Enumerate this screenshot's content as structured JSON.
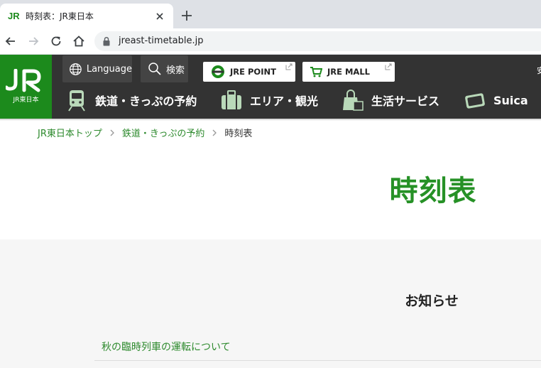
{
  "browser": {
    "tab_title": "時刻表：JR東日本",
    "url": "jreast-timetable.jp"
  },
  "header": {
    "logo_text": "JR東日本",
    "language_label": "Language",
    "search_label": "検索",
    "jre_point_label": "JRE POINT",
    "jre_mall_label": "JRE MALL",
    "edge_fragment": "安",
    "nav": [
      {
        "label": "鉄道・きっぷの予約",
        "icon": "train-icon"
      },
      {
        "label": "エリア・観光",
        "icon": "suitcase-icon"
      },
      {
        "label": "生活サービス",
        "icon": "shopping-bag-icon"
      },
      {
        "label": "Suica",
        "icon": "suica-card-icon"
      }
    ],
    "colors": {
      "header_bg": "#333333",
      "logo_bg": "#1c8a1c",
      "accent_green": "#269126"
    }
  },
  "breadcrumb": [
    {
      "label": "JR東日本トップ"
    },
    {
      "label": "鉄道・きっぷの予約"
    },
    {
      "label": "時刻表"
    }
  ],
  "page": {
    "title": "時刻表",
    "notice_heading": "お知らせ",
    "notices": [
      "秋の臨時列車の運転について"
    ]
  }
}
